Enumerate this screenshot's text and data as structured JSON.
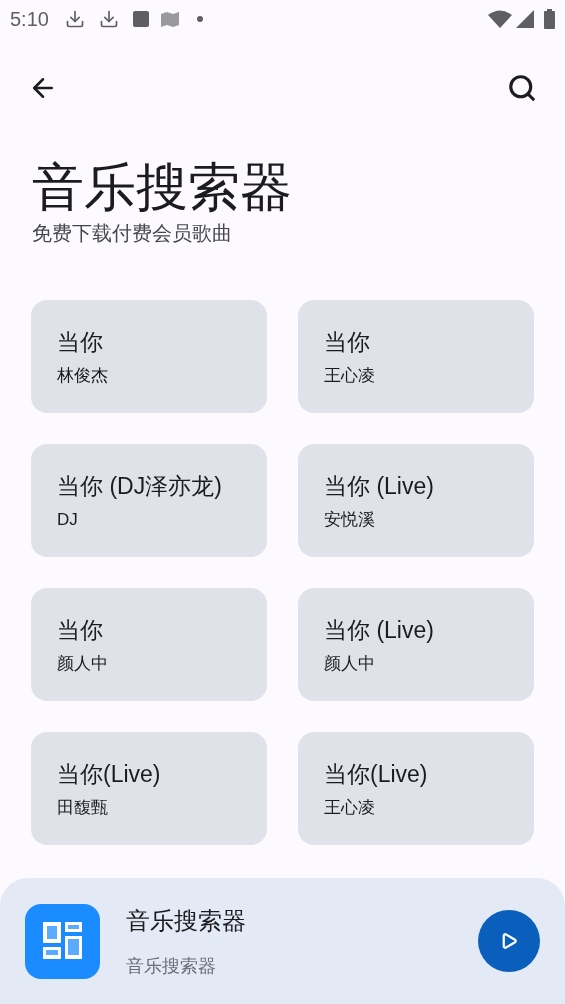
{
  "status_bar": {
    "time": "5:10"
  },
  "header": {
    "title": "音乐搜索器",
    "subtitle": "免费下载付费会员歌曲"
  },
  "songs": [
    {
      "title": "当你",
      "artist": "林俊杰"
    },
    {
      "title": "当你",
      "artist": "王心凌"
    },
    {
      "title": "当你 (DJ泽亦龙)",
      "artist": "DJ"
    },
    {
      "title": "当你 (Live)",
      "artist": "安悦溪"
    },
    {
      "title": "当你",
      "artist": "颜人中"
    },
    {
      "title": "当你 (Live)",
      "artist": "颜人中"
    },
    {
      "title": "当你(Live)",
      "artist": "田馥甄"
    },
    {
      "title": "当你(Live)",
      "artist": "王心凌"
    }
  ],
  "player": {
    "title": "音乐搜索器",
    "subtitle": "音乐搜索器"
  }
}
